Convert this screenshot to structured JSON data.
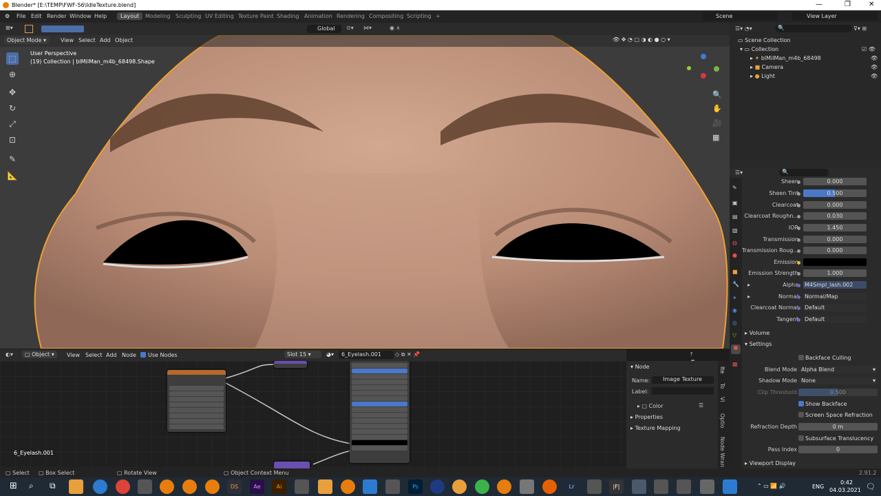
{
  "title": {
    "app": "Blender* [E:\\TEMP\\FWF-56\\IdleTexture.blend]"
  },
  "menus": [
    "File",
    "Edit",
    "Render",
    "Window",
    "Help"
  ],
  "workspaces": [
    "Layout",
    "Modeling",
    "Sculpting",
    "UV Editing",
    "Texture Paint",
    "Shading",
    "Animation",
    "Rendering",
    "Compositing",
    "Scripting"
  ],
  "topright": {
    "scene": "Scene",
    "view_layer": "View Layer"
  },
  "toolheader": {
    "orientation": "Global",
    "options": "Options"
  },
  "viewport": {
    "mode": "Object Mode",
    "menus": [
      "View",
      "Select",
      "Add",
      "Object"
    ],
    "info_line1": "User Perspective",
    "info_line2": "(19) Collection | blMilMan_m4b_68498.Shape"
  },
  "outliner": {
    "scene_collection": "Scene Collection",
    "collection": "Collection",
    "items": [
      "blMilMan_m4b_68498",
      "Camera",
      "Light"
    ]
  },
  "properties": {
    "rows": [
      {
        "label": "Sheen",
        "value": "0.000"
      },
      {
        "label": "Sheen Tint",
        "value": "0.500"
      },
      {
        "label": "Clearcoat",
        "value": "0.000"
      },
      {
        "label": "Clearcoat Roughn...",
        "value": "0.030"
      },
      {
        "label": "IOR",
        "value": "1.450"
      },
      {
        "label": "Transmission",
        "value": "0.000"
      },
      {
        "label": "Transmission Roug...",
        "value": "0.000"
      },
      {
        "label": "Emission",
        "value": ""
      },
      {
        "label": "Emission Strength",
        "value": "1.000"
      },
      {
        "label": "Alpha",
        "value": "M4Smpl_lash.002"
      },
      {
        "label": "Normal",
        "value": "Normal/Map"
      },
      {
        "label": "Clearcoat Normal",
        "value": "Default"
      },
      {
        "label": "Tangent",
        "value": "Default"
      }
    ],
    "volume": "Volume",
    "settings": "Settings",
    "backface_culling": "Backface Culling",
    "blend_mode_label": "Blend Mode",
    "blend_mode": "Alpha Blend",
    "shadow_mode_label": "Shadow Mode",
    "shadow_mode": "None",
    "clip_threshold_label": "Clip Threshold",
    "clip_threshold": "0.500",
    "show_backface": "Show Backface",
    "ssr": "Screen Space Refraction",
    "refraction_depth_label": "Refraction Depth",
    "refraction_depth": "0 m",
    "subsurface": "Subsurface Translucency",
    "pass_index_label": "Pass Index",
    "pass_index": "0",
    "viewport_display": "Viewport Display"
  },
  "node_editor": {
    "object": "Object",
    "menus": [
      "View",
      "Select",
      "Add",
      "Node"
    ],
    "use_nodes": "Use Nodes",
    "slot": "Slot 15",
    "material": "6_Eyelash.001",
    "bottom_label": "6_Eyelash.001",
    "npanel": {
      "header": "Node",
      "name_label": "Name:",
      "name": "Image Texture",
      "label_label": "Label:",
      "color": "Color",
      "properties": "Properties",
      "texture_mapping": "Texture Mapping"
    },
    "tabs": [
      "Ite",
      "To",
      "Vi",
      "Optio",
      "Node Wran"
    ]
  },
  "statusbar": {
    "select": "Select",
    "box_select": "Box Select",
    "rotate_view": "Rotate View",
    "context_menu": "Object Context Menu",
    "version": "2.91.2"
  },
  "taskbar": {
    "lang": "ENG",
    "time": "0:42",
    "date": "04.03.2021"
  }
}
